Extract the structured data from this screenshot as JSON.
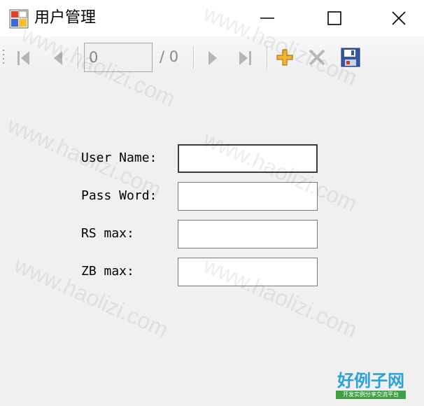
{
  "window": {
    "title": "用户管理",
    "icon": "form-app-icon",
    "controls": {
      "minimize": "minimize-icon",
      "maximize": "maximize-icon",
      "close": "close-icon"
    }
  },
  "navigator": {
    "position_value": "0",
    "count_label": "/ 0",
    "buttons": [
      "move-first-icon",
      "move-previous-icon",
      "move-next-icon",
      "move-last-icon",
      "add-new-icon",
      "delete-icon",
      "save-icon"
    ]
  },
  "form": {
    "fields": [
      {
        "label": "User Name:",
        "value": ""
      },
      {
        "label": "Pass Word:",
        "value": ""
      },
      {
        "label": "RS max:",
        "value": ""
      },
      {
        "label": "ZB max:",
        "value": ""
      }
    ]
  },
  "watermark": {
    "text": "www.haolizi.com",
    "logo_main": "好例子网",
    "logo_sub": "开发实例分享交流平台"
  },
  "colors": {
    "add": "#f2b632",
    "delete": "#b8b8b8",
    "save": "#3456a8",
    "logo_blue": "#2aa3d6",
    "logo_green": "#3fa046"
  }
}
